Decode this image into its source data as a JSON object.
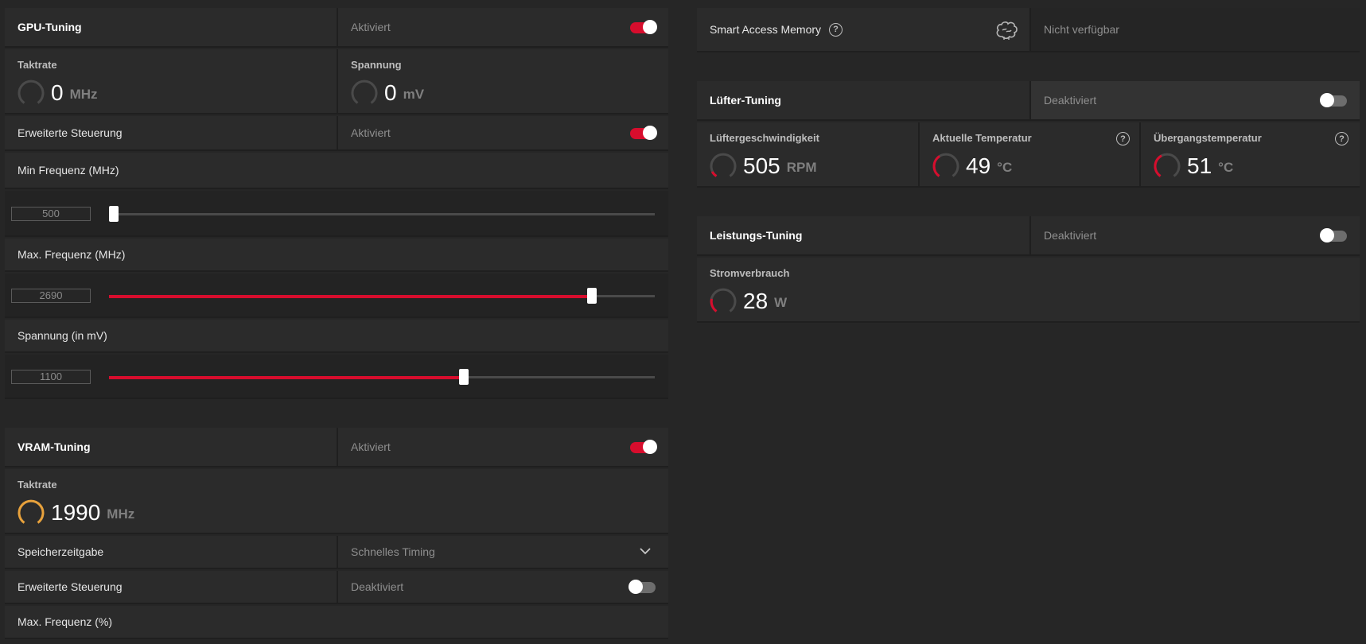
{
  "gpu_tuning": {
    "title": "GPU-Tuning",
    "status": "Aktiviert",
    "clock": {
      "label": "Taktrate",
      "value": "0",
      "unit": "MHz"
    },
    "voltage": {
      "label": "Spannung",
      "value": "0",
      "unit": "mV"
    },
    "advanced": {
      "label": "Erweiterte Steuerung",
      "status": "Aktiviert"
    },
    "min_freq": {
      "label": "Min Frequenz (MHz)",
      "value": "500",
      "fraction": 0.0
    },
    "max_freq": {
      "label": "Max. Frequenz (MHz)",
      "value": "2690",
      "fraction": 0.885
    },
    "voltage_mv": {
      "label": "Spannung (in mV)",
      "value": "1100",
      "fraction": 0.65
    }
  },
  "vram_tuning": {
    "title": "VRAM-Tuning",
    "status": "Aktiviert",
    "clock": {
      "label": "Taktrate",
      "value": "1990",
      "unit": "MHz"
    },
    "memory_timing": {
      "label": "Speicherzeitgabe",
      "value": "Schnelles Timing"
    },
    "advanced": {
      "label": "Erweiterte Steuerung",
      "status": "Deaktiviert"
    },
    "max_freq": {
      "label": "Max. Frequenz (%)"
    }
  },
  "smart_access_memory": {
    "label": "Smart Access Memory",
    "status": "Nicht verfügbar"
  },
  "fan_tuning": {
    "title": "Lüfter-Tuning",
    "status": "Deaktiviert",
    "fan_speed": {
      "label": "Lüftergeschwindigkeit",
      "value": "505",
      "unit": "RPM"
    },
    "current_temp": {
      "label": "Aktuelle Temperatur",
      "value": "49",
      "unit": "°C"
    },
    "junction_temp": {
      "label": "Übergangstemperatur",
      "value": "51",
      "unit": "°C"
    }
  },
  "power_tuning": {
    "title": "Leistungs-Tuning",
    "status": "Deaktiviert",
    "power": {
      "label": "Stromverbrauch",
      "value": "28",
      "unit": "W"
    }
  },
  "icons": {
    "help": "?"
  },
  "colors": {
    "accent": "#d70d2d",
    "vram_gauge": "#e8a23c",
    "background": "#262626"
  }
}
